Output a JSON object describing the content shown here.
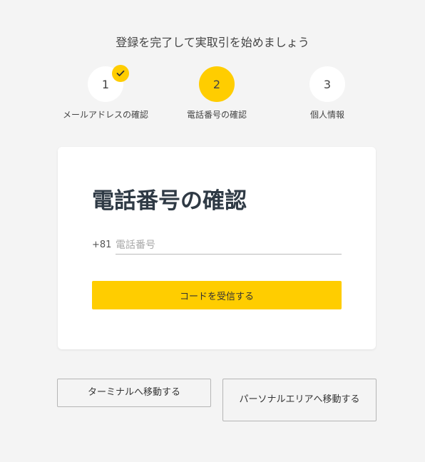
{
  "header": {
    "title": "登録を完了して実取引を始めましょう"
  },
  "steps": [
    {
      "number": "1",
      "label": "メールアドレスの確認",
      "completed": true,
      "active": false,
      "check_icon": "check-icon"
    },
    {
      "number": "2",
      "label": "電話番号の確認",
      "completed": false,
      "active": true
    },
    {
      "number": "3",
      "label": "個人情報",
      "completed": false,
      "active": false
    }
  ],
  "card": {
    "title": "電話番号の確認",
    "country_code": "+81",
    "phone_value": "",
    "phone_placeholder": "電話番号",
    "get_code_label": "コードを受信する"
  },
  "footer": {
    "terminal_label": "ターミナルへ移動する",
    "personal_area_label": "パーソナルエリアへ移動する"
  },
  "colors": {
    "accent": "#ffcd00",
    "background": "#f4f4f4",
    "card": "#ffffff",
    "title": "#2f3a45"
  }
}
